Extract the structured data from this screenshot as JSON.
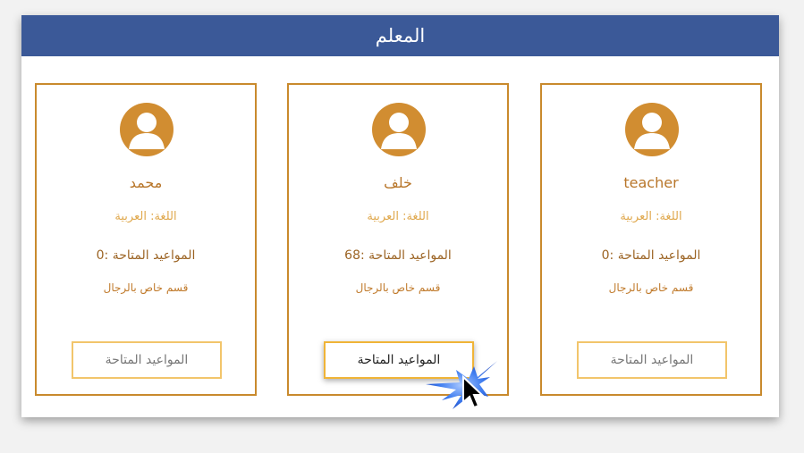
{
  "header": {
    "title": "المعلم"
  },
  "teachers": [
    {
      "name": "teacher",
      "language": "اللغة: العربية",
      "available_slots": "المواعيد المتاحة :0",
      "department": "قسم خاص بالرجال",
      "button_label": "المواعيد المتاحة"
    },
    {
      "name": "خلف",
      "language": "اللغة: العربية",
      "available_slots": "المواعيد المتاحة :68",
      "department": "قسم خاص بالرجال",
      "button_label": "المواعيد المتاحة"
    },
    {
      "name": "محمد",
      "language": "اللغة: العربية",
      "available_slots": "المواعيد المتاحة :0",
      "department": "قسم خاص بالرجال",
      "button_label": "المواعيد المتاحة"
    }
  ],
  "colors": {
    "header_bg": "#3b5998",
    "accent": "#c98a2d",
    "button_border": "#f2c56b"
  },
  "icons": {
    "avatar": "user-avatar-icon",
    "cursor": "mouse-pointer-icon"
  }
}
